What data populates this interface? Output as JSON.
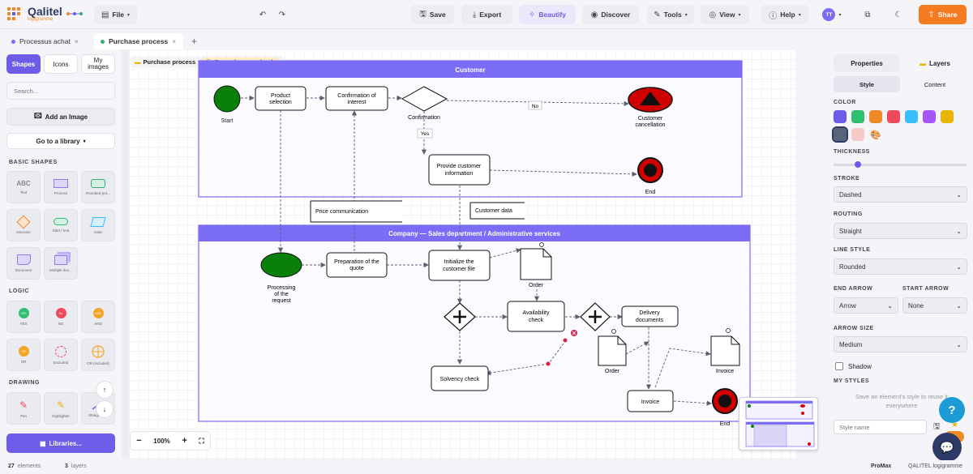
{
  "app": {
    "logo_name": "Qalitel",
    "logo_sub": "logigramme"
  },
  "toolbar": {
    "file": "File",
    "save": "Save",
    "export": "Export",
    "beautify": "Beautify",
    "discover": "Discover",
    "tools": "Tools",
    "view": "View",
    "help": "Help",
    "avatar": "TT",
    "share": "Share"
  },
  "tabs": [
    {
      "label": "Processus achat",
      "color": "#7b6cf6"
    },
    {
      "label": "Purchase process",
      "color": "#3aa876"
    }
  ],
  "left": {
    "tab_shapes": "Shapes",
    "tab_icons": "Icons",
    "tab_images_1": "My",
    "tab_images_2": "images",
    "search_placeholder": "Search...",
    "add_image": "Add an Image",
    "library": "Go to a library",
    "basic_title": "BASIC SHAPES",
    "logic_title": "LOGIC",
    "drawing_title": "DRAWING",
    "basic": [
      "Text",
      "Process",
      "Rounded pro...",
      "Decision",
      "Start / end",
      "Data",
      "Document",
      "Multiple doc..."
    ],
    "logic": [
      "YES",
      "NO",
      "AND",
      "OR",
      "Excluded",
      "OR (included)"
    ],
    "logic_marks": [
      "YES",
      "No",
      "AND",
      "OR"
    ],
    "drawing": [
      "Pen",
      "Highlighter",
      "Straight line"
    ],
    "libraries": "Libraries..."
  },
  "canvas": {
    "breadcrumb": "Purchase process",
    "readonly": "Example — read-only",
    "zoom": "100%",
    "pools": {
      "customer": "Customer",
      "company": "Company — Sales department / Administrative services"
    },
    "nodes": {
      "start": "Start",
      "product": [
        "Product",
        "selection"
      ],
      "confirm_int": [
        "Confirmation of",
        "interest"
      ],
      "confirmation": "Confirmation",
      "no": "No",
      "yes": "Yes",
      "cancel": [
        "Customer",
        "cancellation"
      ],
      "provide": [
        "Provide customer",
        "information"
      ],
      "end1": "End",
      "price": "Price communication",
      "custdata": "Customer data",
      "processing": [
        "Processing",
        "of the",
        "request"
      ],
      "quote": [
        "Preparation of the",
        "quote"
      ],
      "init": [
        "Initialize the",
        "customer file"
      ],
      "order1": "Order",
      "avail": [
        "Availability",
        "check"
      ],
      "delivery": [
        "Delivery",
        "documents"
      ],
      "order2": "Order",
      "invoice_doc": "Invoice",
      "solvency": "Solvency check",
      "invoice": "Invoice",
      "end2": "End"
    }
  },
  "right": {
    "tab_properties": "Properties",
    "tab_layers": "Layers",
    "sub_style": "Style",
    "sub_content": "Content",
    "color": "COLOR",
    "thickness": "THICKNESS",
    "stroke": "STROKE",
    "stroke_val": "Dashed",
    "routing": "ROUTING",
    "routing_val": "Straight",
    "line_style": "LINE STYLE",
    "line_style_val": "Rounded",
    "end_arrow": "END ARROW",
    "end_arrow_val": "Arrow",
    "start_arrow": "START ARROW",
    "start_arrow_val": "None",
    "arrow_size": "ARROW SIZE",
    "arrow_size_val": "Medium",
    "shadow": "Shadow",
    "my_styles": "MY STYLES",
    "styles_hint": "Save an element's style to reuse it everywhere",
    "style_name_placeholder": "Style name",
    "swatches": [
      "#6c5ce7",
      "#2fbf71",
      "#f08a24",
      "#ef4a5a",
      "#38bdf8",
      "#a855f7",
      "#eab308",
      "#5a6478",
      "#f6c9c9"
    ]
  },
  "status": {
    "elements": "27",
    "elements_label": "elements",
    "layers": "3",
    "layers_label": "layers",
    "plan": "ProMax",
    "brand": "QALITEL logigramme"
  }
}
